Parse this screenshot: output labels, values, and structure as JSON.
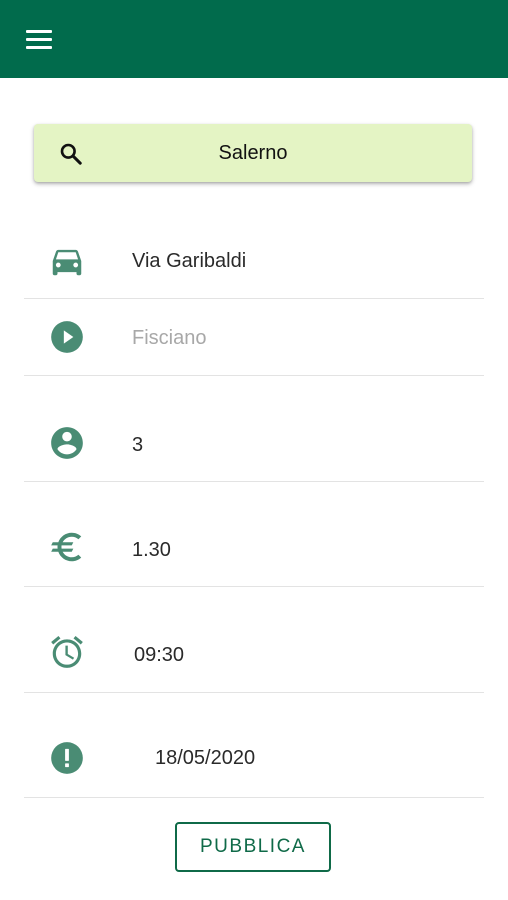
{
  "colors": {
    "appbar": "#016b4c",
    "search_background": "#e4f4c4",
    "icon": "#4a8c74",
    "accent": "#0f6a48"
  },
  "appbar": {
    "menu_icon": "hamburger-menu-icon"
  },
  "search": {
    "icon": "search-icon",
    "value": "Salerno"
  },
  "form": {
    "street": {
      "icon": "car-icon",
      "value": "Via Garibaldi"
    },
    "destination": {
      "icon": "play-circle-icon",
      "placeholder": "Fisciano"
    },
    "seats": {
      "icon": "account-circle-icon",
      "value": "3"
    },
    "price": {
      "icon": "euro-icon",
      "value": "1.30"
    },
    "time": {
      "icon": "alarm-clock-icon",
      "value": "09:30"
    },
    "date": {
      "icon": "alert-circle-icon",
      "value": "18/05/2020"
    }
  },
  "actions": {
    "publish_label": "PUBBLICA"
  }
}
